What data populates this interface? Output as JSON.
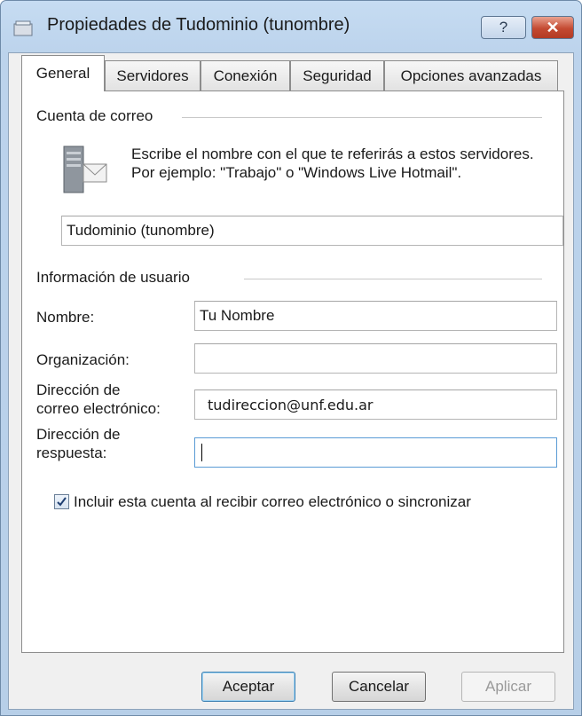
{
  "window": {
    "title": "Propiedades de Tudominio (tunombre)"
  },
  "titlebar": {
    "help_label": "?",
    "close_label": "✕"
  },
  "tabs": [
    {
      "label": "General",
      "active": true
    },
    {
      "label": "Servidores",
      "active": false
    },
    {
      "label": "Conexión",
      "active": false
    },
    {
      "label": "Seguridad",
      "active": false
    },
    {
      "label": "Opciones avanzadas",
      "active": false
    }
  ],
  "account": {
    "group_label": "Cuenta de correo",
    "description": "Escribe el nombre con el que te referirás a estos servidores. Por ejemplo: \"Trabajo\" o \"Windows Live Hotmail\".",
    "icon": "mail-server-icon",
    "name_value": "Tudominio (tunombre)"
  },
  "user": {
    "group_label": "Información de usuario",
    "fields": {
      "name": {
        "label": "Nombre:",
        "value": "Tu Nombre"
      },
      "organization": {
        "label": "Organización:",
        "value": ""
      },
      "email": {
        "label_line1": "Dirección de",
        "label_line2": "correo electrónico:",
        "value": "tudireccion@unf.edu.ar"
      },
      "reply": {
        "label_line1": "Dirección de",
        "label_line2": "respuesta:",
        "value": ""
      }
    }
  },
  "include": {
    "label": "Incluir esta cuenta al recibir correo electrónico o sincronizar",
    "checked": true
  },
  "buttons": {
    "ok": "Aceptar",
    "cancel": "Cancelar",
    "apply": "Aplicar"
  },
  "colors": {
    "titlebar": "#bcd3ec",
    "close": "#c44a32",
    "default_button_border": "#3c7fb1"
  }
}
